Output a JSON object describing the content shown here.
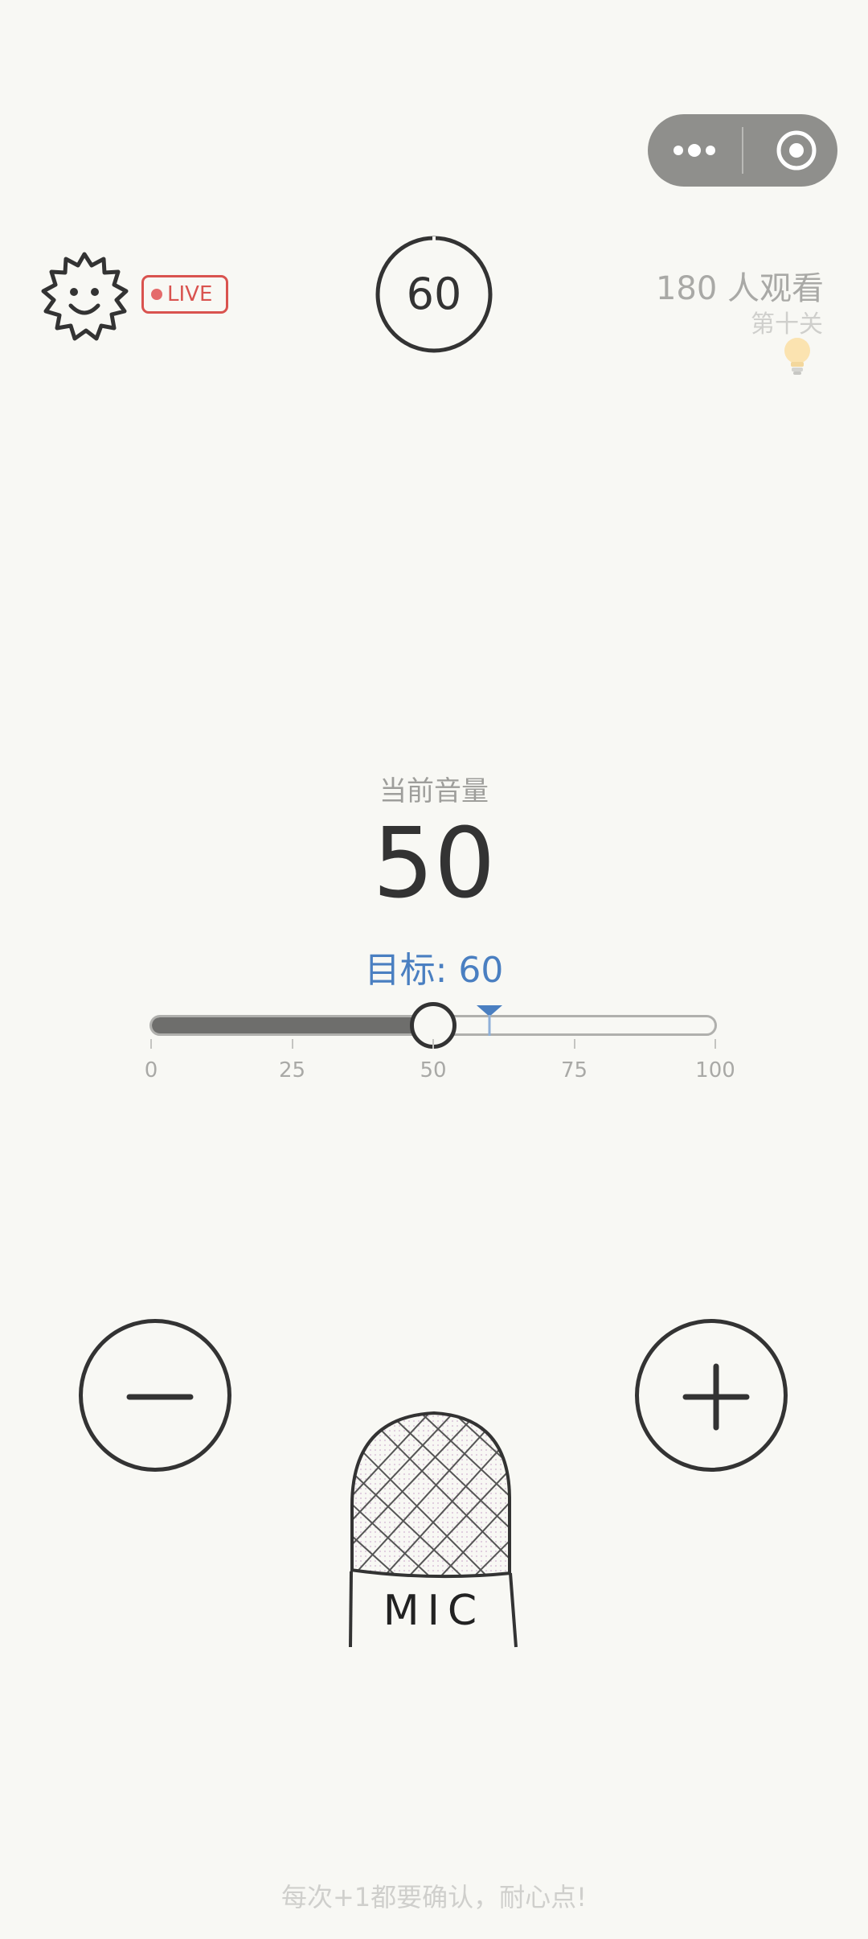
{
  "menu": {
    "more_icon": "more-dots-icon",
    "close_icon": "target-circle-icon"
  },
  "header": {
    "live_label": "LIVE",
    "timer": "60",
    "viewers": "180 人观看",
    "level": "第十关",
    "hint_icon": "lightbulb-icon"
  },
  "volume": {
    "label": "当前音量",
    "current": "50",
    "target_label": "目标: 60",
    "current_value": 50,
    "target_value": 60,
    "scale": [
      "0",
      "25",
      "50",
      "75",
      "100"
    ]
  },
  "controls": {
    "minus_icon": "minus-icon",
    "plus_icon": "plus-icon",
    "mic_label": "MIC"
  },
  "footer": {
    "tip": "每次+1都要确认，耐心点!"
  },
  "colors": {
    "accent": "#4a7fc1",
    "live": "#d9534f",
    "ink": "#333333",
    "background": "#f8f8f4"
  }
}
